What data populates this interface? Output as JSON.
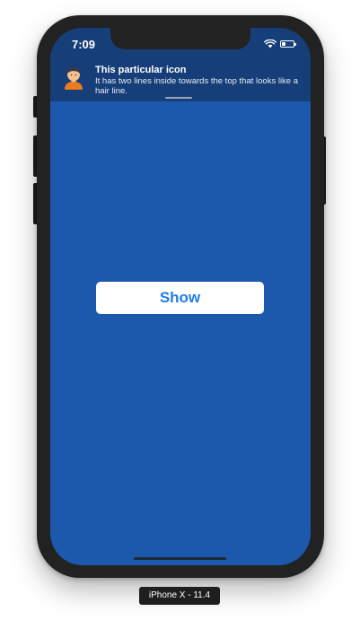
{
  "status_bar": {
    "time": "7:09",
    "wifi_icon": "wifi-icon",
    "battery_icon": "battery-icon"
  },
  "notification": {
    "avatar_icon": "person-avatar-icon",
    "title": "This particular icon",
    "body": "It has two lines inside towards the top that looks like a hair line."
  },
  "main": {
    "show_button_label": "Show"
  },
  "simulator": {
    "device_label": "iPhone X - 11.4"
  },
  "colors": {
    "screen_background": "#1c58ab",
    "banner_background": "#163e78",
    "button_text": "#1e7ee8",
    "device_frame": "#222222"
  }
}
